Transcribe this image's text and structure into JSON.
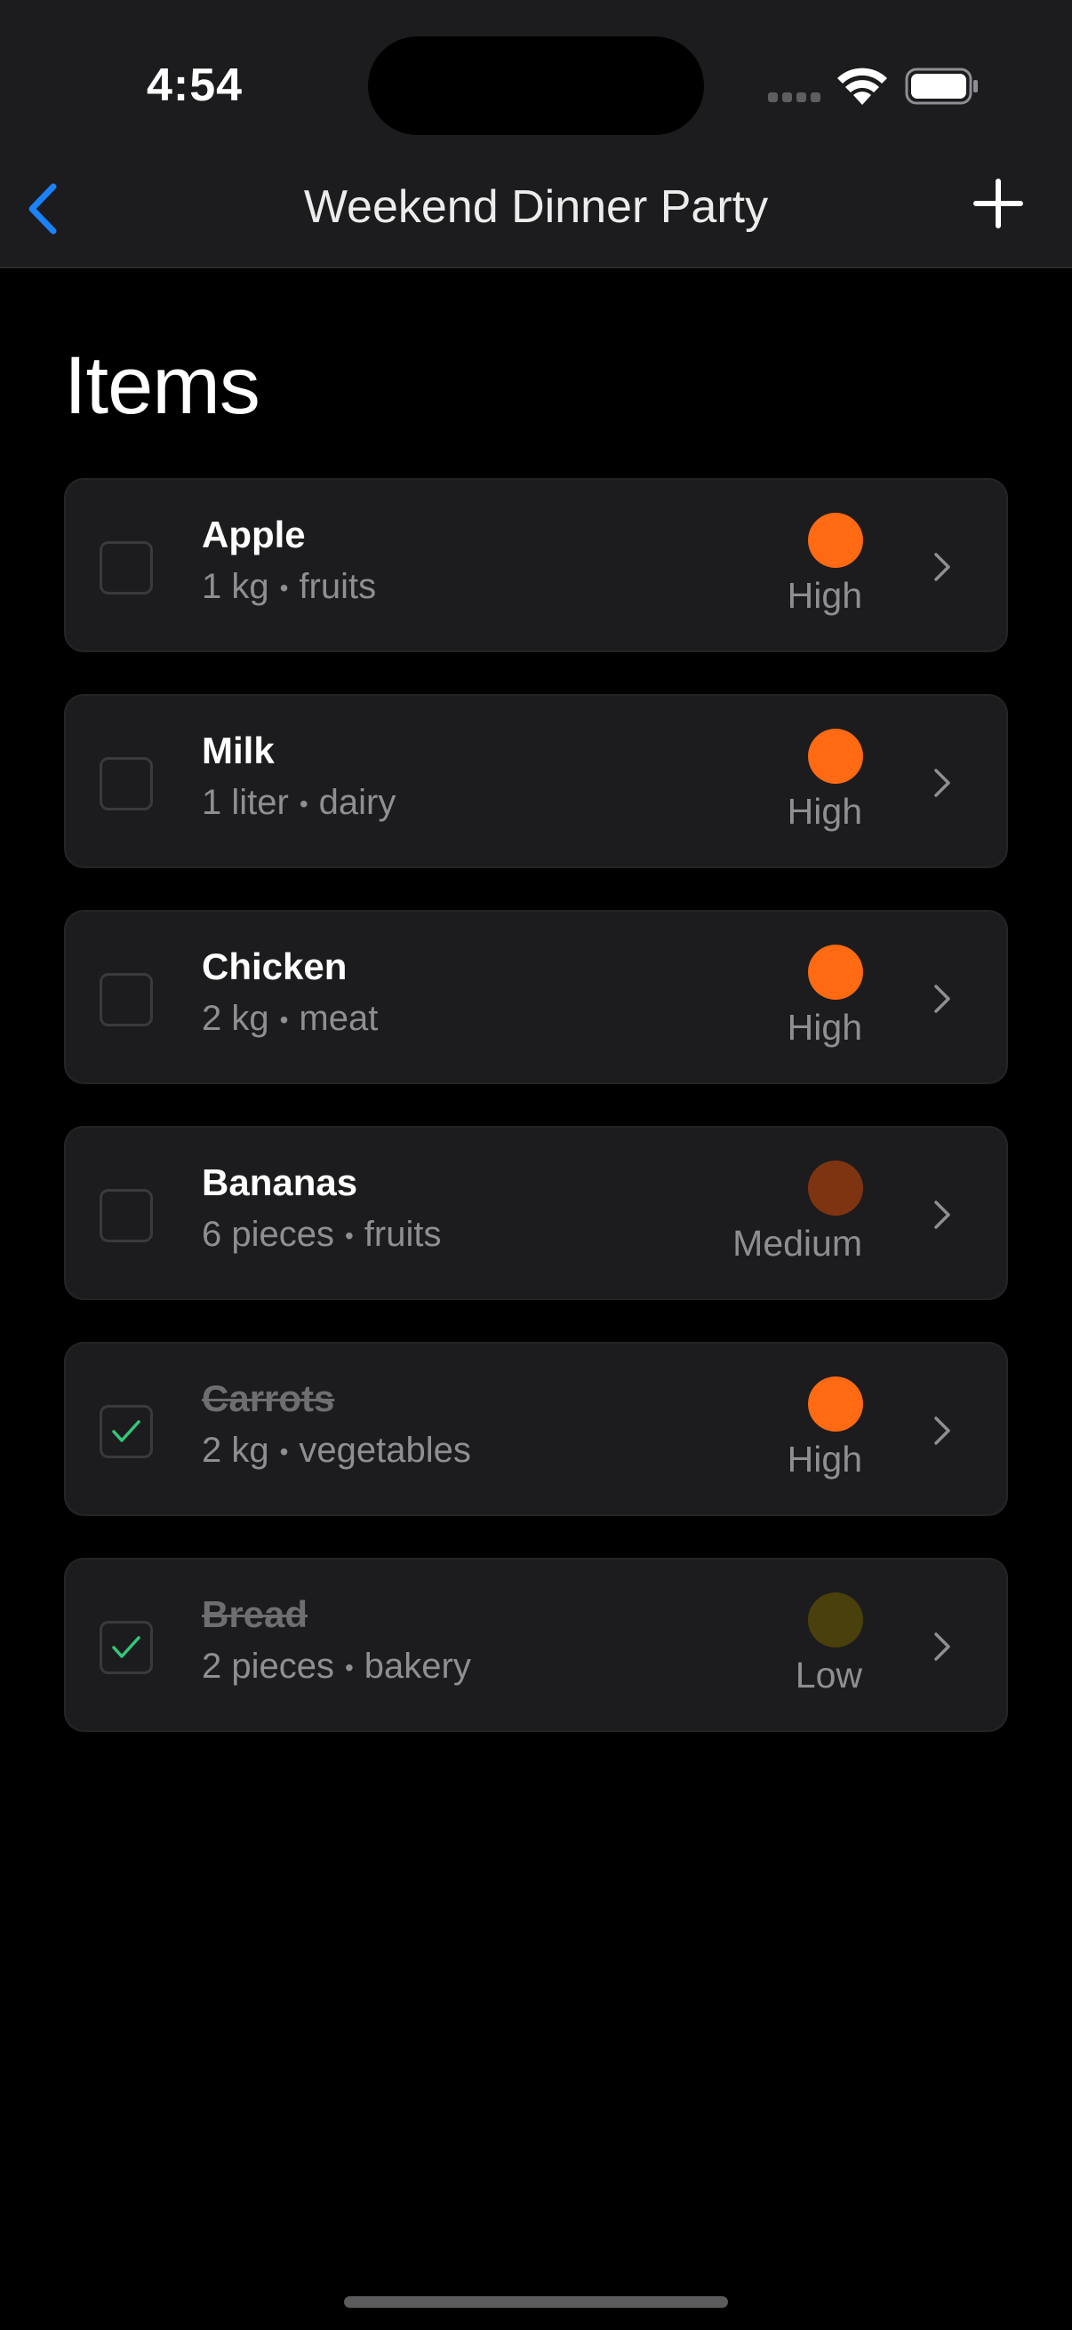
{
  "status_bar": {
    "time": "4:54"
  },
  "nav": {
    "title": "Weekend Dinner Party"
  },
  "section": {
    "title": "Items"
  },
  "colors": {
    "accent": "#1a82fb",
    "high": "#ff6a12",
    "medium": "#7e3410",
    "low": "#4a400b",
    "check": "#34c77b"
  },
  "items": [
    {
      "name": "Apple",
      "quantity": "1 kg",
      "category": "fruits",
      "priority": "High",
      "checked": false
    },
    {
      "name": "Milk",
      "quantity": "1 liter",
      "category": "dairy",
      "priority": "High",
      "checked": false
    },
    {
      "name": "Chicken",
      "quantity": "2 kg",
      "category": "meat",
      "priority": "High",
      "checked": false
    },
    {
      "name": "Bananas",
      "quantity": "6 pieces",
      "category": "fruits",
      "priority": "Medium",
      "checked": false
    },
    {
      "name": "Carrots",
      "quantity": "2 kg",
      "category": "vegetables",
      "priority": "High",
      "checked": true
    },
    {
      "name": "Bread",
      "quantity": "2 pieces",
      "category": "bakery",
      "priority": "Low",
      "checked": true
    }
  ],
  "separator": "•"
}
